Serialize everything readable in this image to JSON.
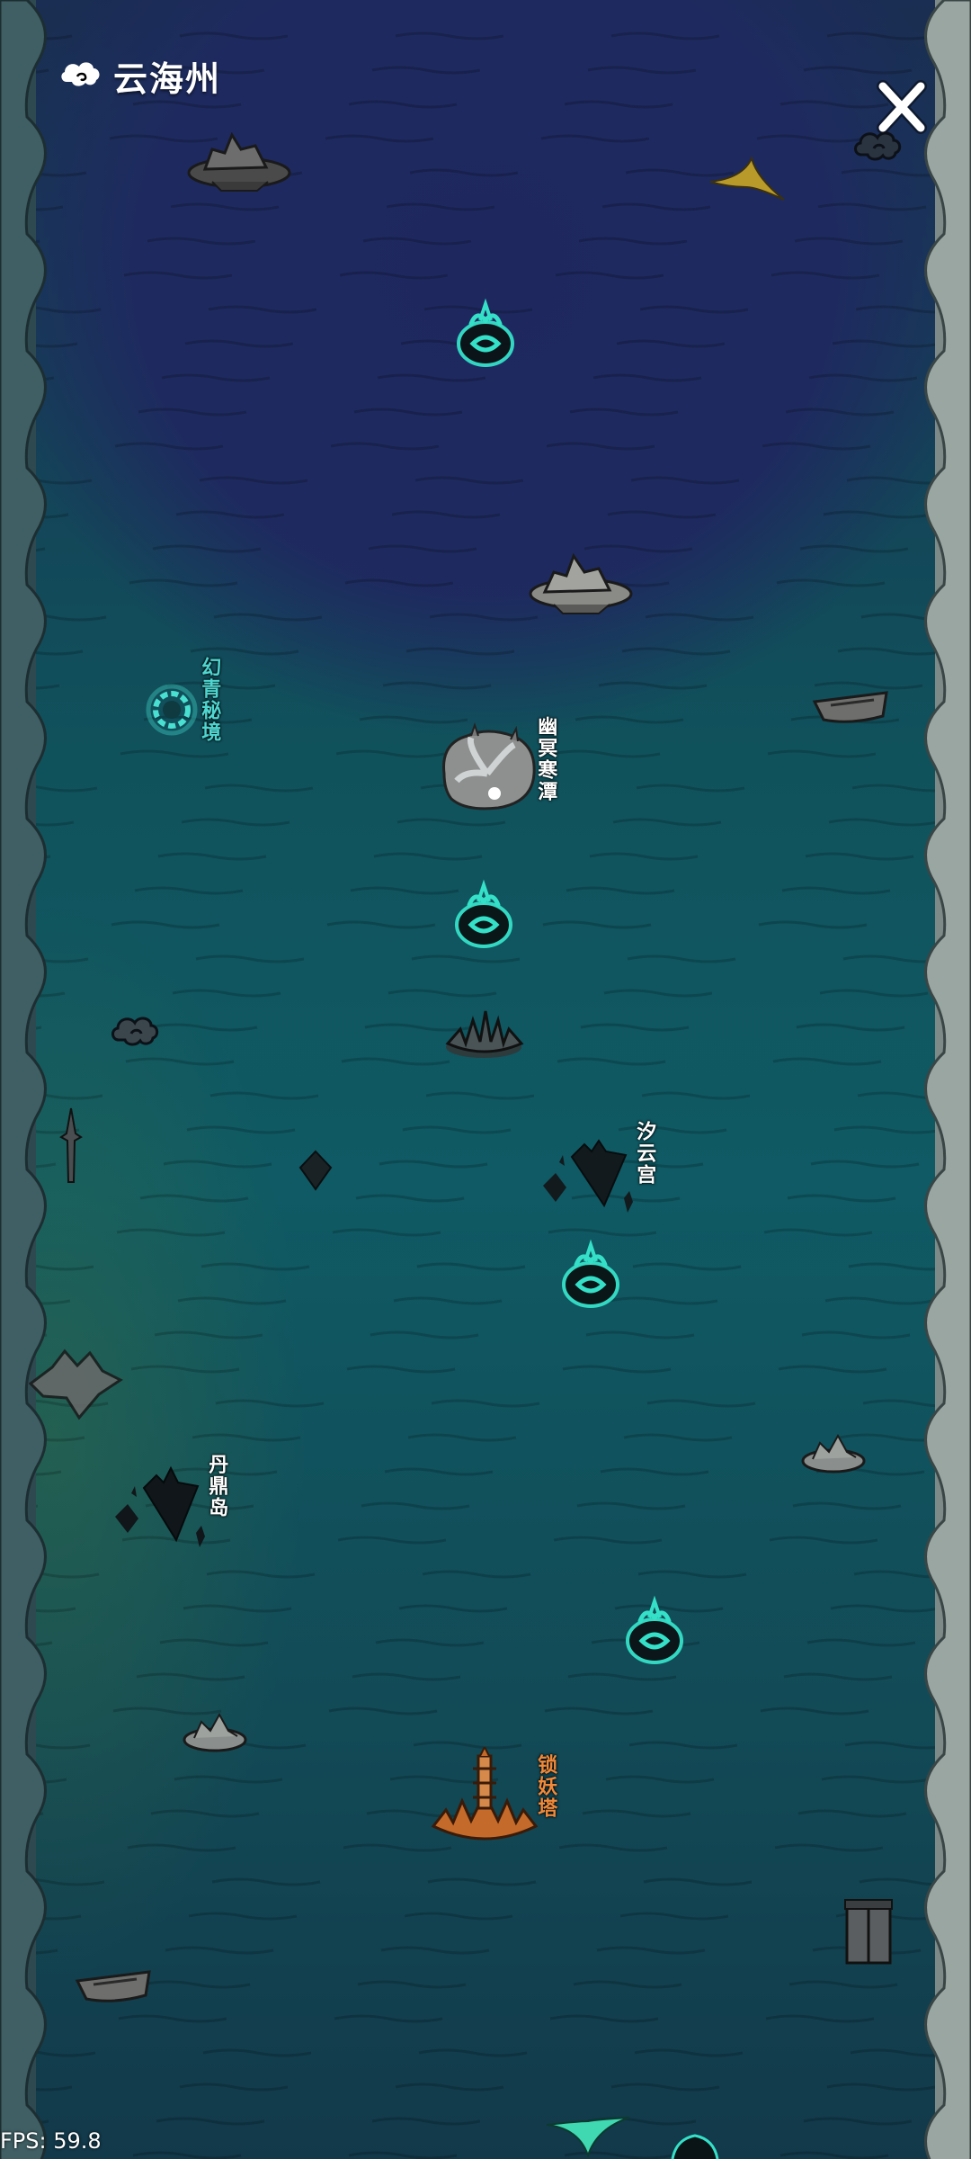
{
  "header": {
    "title": "云海州",
    "logo_icon": "auspicious-cloud-icon"
  },
  "close": {
    "label": "X",
    "icon": "close-icon"
  },
  "labels": {
    "huanqing": "幻青秘境",
    "youming": "幽冥寒潭",
    "xiyun": "汐云宫",
    "danding": "丹鼎岛",
    "suoyao": "锁妖塔"
  },
  "colors": {
    "deep_sea": "#1e2a5f",
    "shallow_sea": "#0f5a64",
    "cyan_label": "#4fd6d0",
    "white_label": "#ffffff",
    "orange_label": "#f08a3a",
    "demon_glow": "#35e0c8"
  },
  "fps": {
    "text": "FPS: 59.8"
  }
}
